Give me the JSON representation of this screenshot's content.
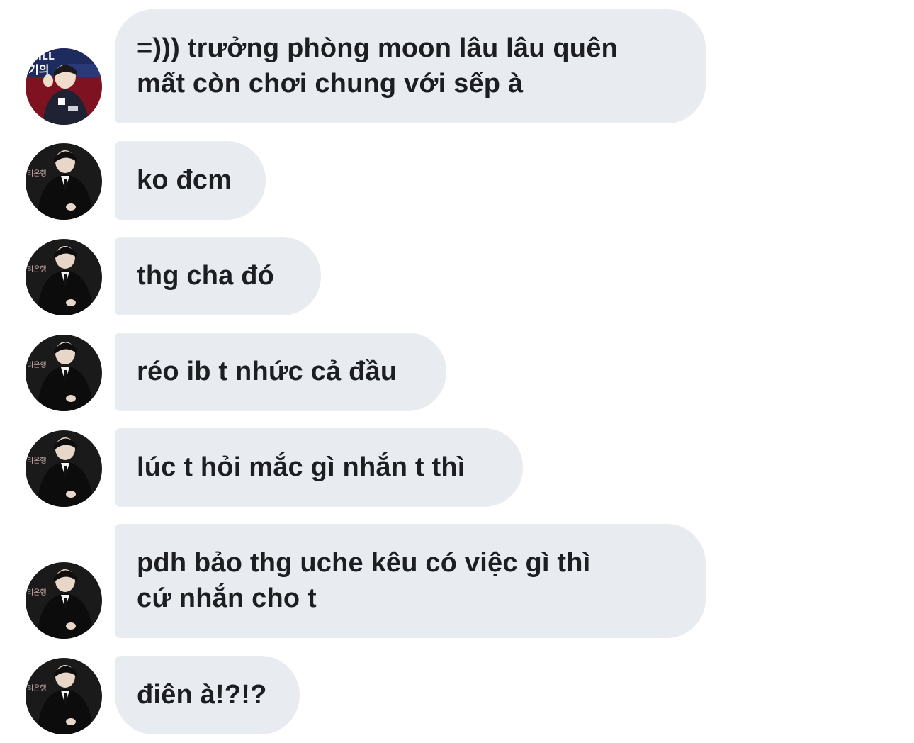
{
  "messages": [
    {
      "sender": "other",
      "lines": [
        "=))) trưởng phòng moon lâu lâu quên",
        "mất còn chơi chung với sếp à"
      ]
    },
    {
      "sender": "self",
      "lines": [
        "ko đcm"
      ]
    },
    {
      "sender": "self",
      "lines": [
        "thg cha đó"
      ]
    },
    {
      "sender": "self",
      "lines": [
        "réo ib t nhức cả đầu"
      ]
    },
    {
      "sender": "self",
      "lines": [
        "lúc t hỏi mắc gì nhắn t thì"
      ]
    },
    {
      "sender": "self",
      "lines": [
        "pdh bảo thg uche kêu có việc gì thì",
        "cứ nhắn cho t"
      ]
    },
    {
      "sender": "self",
      "lines": [
        "điên à!?!?"
      ]
    }
  ],
  "avatar_a_text": "HILL",
  "avatar_a_sub": "기의",
  "avatar_b_text": "리온행",
  "colors": {
    "bubble_bg": "#e8ecf0",
    "text": "#1c1e21",
    "avatar_a_bg": "#8a1020",
    "avatar_b_bg": "#1a1a1a"
  }
}
